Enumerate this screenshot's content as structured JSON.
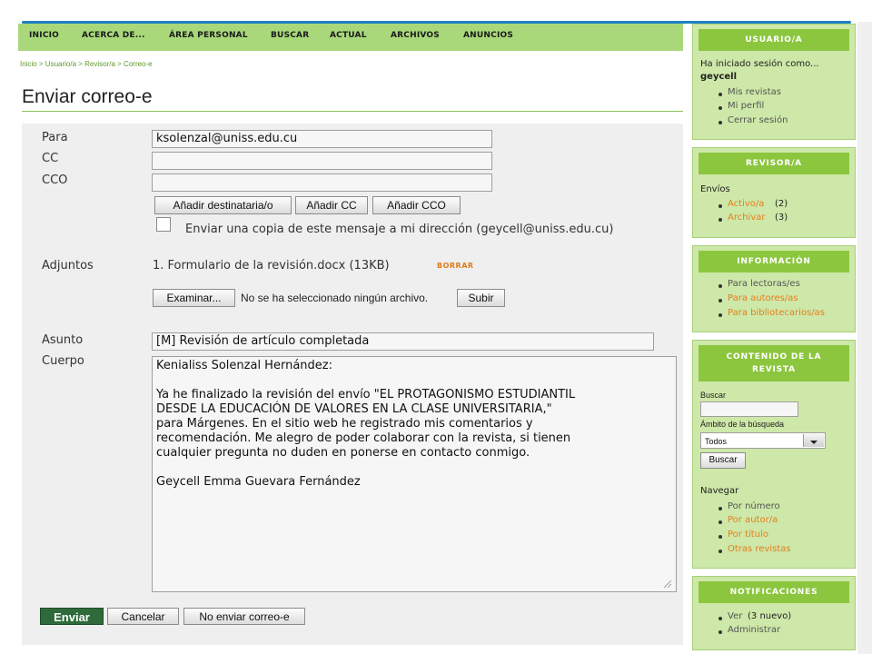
{
  "nav": {
    "items": [
      "INICIO",
      "ACERCA DE...",
      "ÁREA PERSONAL",
      "BUSCAR",
      "ACTUAL",
      "ARCHIVOS",
      "ANUNCIOS"
    ]
  },
  "breadcrumb": "Inicio > Usuario/a > Revisor/a > Correo-e",
  "page_title": "Enviar correo-e",
  "form": {
    "to_label": "Para",
    "to_value": "ksolenzal@uniss.edu.cu",
    "cc_label": "CC",
    "cc_value": "",
    "bcc_label": "CCO",
    "bcc_value": "",
    "add_recipient": "Añadir destinataria/o",
    "add_cc": "Añadir CC",
    "add_bcc": "Añadir CCO",
    "copy_label": "Enviar una copia de este mensaje a mi dirección (geycell@uniss.edu.cu)",
    "attachments_label": "Adjuntos",
    "attachment_file": "1. Formulario de la revisión.docx (13KB)",
    "attachment_delete": "BORRAR",
    "browse_button": "Examinar...",
    "no_file_text": "No se ha seleccionado ningún archivo.",
    "upload_button": "Subir",
    "subject_label": "Asunto",
    "subject_value": "[M] Revisión de artículo completada",
    "body_label": "Cuerpo",
    "body_value": "Kenialiss Solenzal Hernández:\n\nYa he finalizado la revisión del envío \"EL PROTAGONISMO ESTUDIANTIL\nDESDE LA EDUCACIÓN DE VALORES EN LA CLASE UNIVERSITARIA,\"\npara Márgenes. En el sitio web he registrado mis comentarios y\nrecomendación. Me alegro de poder colaborar con la revista, si tienen\ncualquier pregunta no duden en ponerse en contacto conmigo.\n\nGeycell Emma Guevara Fernández",
    "send_button": "Enviar",
    "cancel_button": "Cancelar",
    "dont_send_button": "No enviar correo-e"
  },
  "sidebar": {
    "user": {
      "title": "USUARIO/A",
      "logged_as": "Ha iniciado sesión como...",
      "username": "geycell",
      "links": [
        "Mis revistas",
        "Mi perfil",
        "Cerrar sesión"
      ]
    },
    "reviewer": {
      "title": "REVISOR/A",
      "submissions_label": "Envíos",
      "active_label": "Activo/a",
      "active_count": "(2)",
      "archive_label": "Archivar",
      "archive_count": "(3)"
    },
    "information": {
      "title": "INFORMACIÓN",
      "links": [
        "Para lectoras/es",
        "Para autores/as",
        "Para bibliotecarios/as"
      ]
    },
    "journal_content": {
      "title_line1": "CONTENIDO DE LA",
      "title_line2": "REVISTA",
      "search_label": "Buscar",
      "search_value": "",
      "scope_label": "Ámbito de la búsqueda",
      "scope_value": "Todos",
      "search_button": "Buscar",
      "browse_label": "Navegar",
      "browse_links": [
        "Por número",
        "Por autor/a",
        "Por título",
        "Otras revistas"
      ]
    },
    "notifications": {
      "title": "NOTIFICACIONES",
      "view_label": "Ver",
      "view_count": "(3 nuevo)",
      "manage_label": "Administrar"
    }
  },
  "colors": {
    "nav_green": "#a8d87a",
    "sidebar_header": "#8cc63f",
    "sidebar_bg": "#cde8a8",
    "send_button": "#2f6b3a",
    "link_orange": "#e87d1e",
    "top_line_blue": "#1f7fc4"
  }
}
